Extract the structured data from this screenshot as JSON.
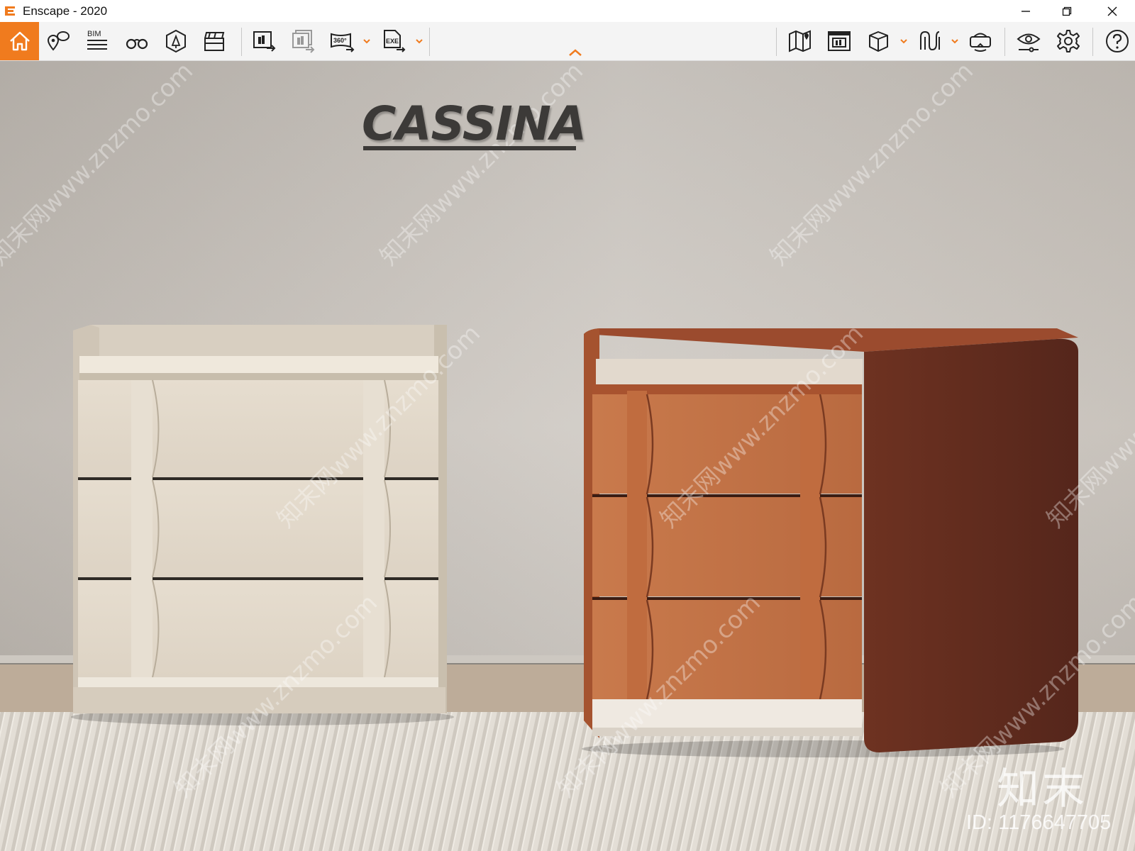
{
  "window": {
    "title": "Enscape - 2020",
    "accent_color": "#f07b1e"
  },
  "toolbar": {
    "bim_label": "BIM",
    "panorama_label": "360°",
    "exe_label": "EXE",
    "left_tools": [
      "home-icon",
      "location-pin-icon",
      "bim-icon",
      "binoculars-icon",
      "asset-library-icon",
      "clapperboard-icon",
      "screenshot-export-icon",
      "batch-render-icon",
      "panorama-360-icon",
      "exe-export-icon"
    ],
    "right_tools": [
      "map-icon",
      "views-icon",
      "cube-icon",
      "sync-icon",
      "vr-headset-icon",
      "visual-settings-icon",
      "settings-gear-icon",
      "help-icon"
    ]
  },
  "viewport": {
    "brand_text": "CASSINA",
    "watermark_logo": "知末",
    "watermark_id": "ID: 1176647705",
    "watermark_url": "知末网www.znzmo.com"
  }
}
